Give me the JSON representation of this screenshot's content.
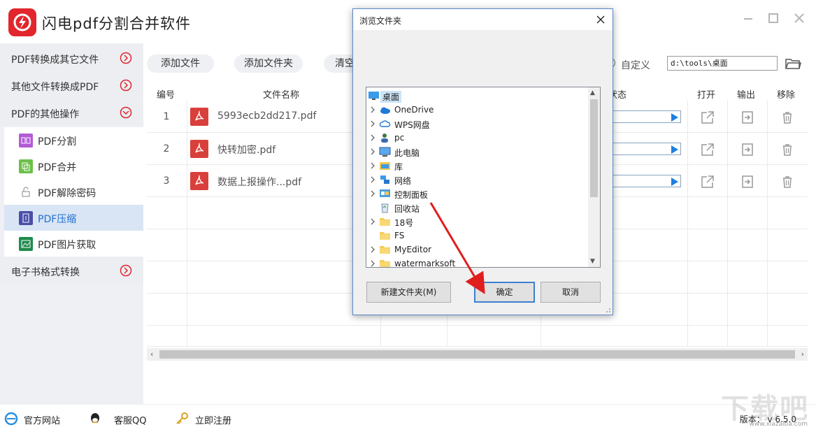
{
  "app": {
    "title": "闪电pdf分割合并软件",
    "brand_color": "#e1262d"
  },
  "sidebar": {
    "categories": [
      {
        "label": "PDF转换成其它文件"
      },
      {
        "label": "其他文件转换成PDF"
      },
      {
        "label": "PDF的其他操作"
      },
      {
        "label": "电子书格式转换"
      }
    ],
    "sub_items": [
      {
        "label": "PDF分割",
        "icon": "split-icon"
      },
      {
        "label": "PDF合并",
        "icon": "merge-icon"
      },
      {
        "label": "PDF解除密码",
        "icon": "unlock-icon"
      },
      {
        "label": "PDF压缩",
        "icon": "compress-icon",
        "active": true
      },
      {
        "label": "PDF图片获取",
        "icon": "image-extract-icon"
      }
    ]
  },
  "toolbar": {
    "add_file": "添加文件",
    "add_folder": "添加文件夹",
    "clear": "清空",
    "custom_label": "自定义",
    "output_path": "d:\\tools\\桌面"
  },
  "table": {
    "headers": {
      "no": "编号",
      "name": "文件名称",
      "status": "状态",
      "open": "打开",
      "output": "输出",
      "remove": "移除"
    },
    "rows": [
      {
        "no": "1",
        "name": "5993ecb2dd217.pdf"
      },
      {
        "no": "2",
        "name": "快转加密.pdf"
      },
      {
        "no": "3",
        "name": "数据上报操作...pdf"
      }
    ]
  },
  "footer": {
    "website": "官方网站",
    "qq": "客服QQ",
    "register": "立即注册",
    "version": "版本： v 6.5.0",
    "watermark": "下载吧",
    "watermark_url": "www.xiazaiba.com"
  },
  "dialog": {
    "title": "浏览文件夹",
    "tree": [
      {
        "label": "桌面",
        "icon": "desktop-icon",
        "expandable": false,
        "selected": true,
        "root": true
      },
      {
        "label": "OneDrive",
        "icon": "onedrive-icon",
        "expandable": true
      },
      {
        "label": "WPS网盘",
        "icon": "wps-cloud-icon",
        "expandable": true
      },
      {
        "label": "pc",
        "icon": "user-icon",
        "expandable": true
      },
      {
        "label": "此电脑",
        "icon": "computer-icon",
        "expandable": true
      },
      {
        "label": "库",
        "icon": "library-icon",
        "expandable": true
      },
      {
        "label": "网络",
        "icon": "network-icon",
        "expandable": true
      },
      {
        "label": "控制面板",
        "icon": "control-panel-icon",
        "expandable": true
      },
      {
        "label": "回收站",
        "icon": "recycle-bin-icon",
        "expandable": false
      },
      {
        "label": "18号",
        "icon": "folder-icon",
        "expandable": true
      },
      {
        "label": "FS",
        "icon": "folder-icon",
        "expandable": false
      },
      {
        "label": "MyEditor",
        "icon": "folder-icon",
        "expandable": true
      },
      {
        "label": "watermarksoft",
        "icon": "folder-icon",
        "expandable": true
      }
    ],
    "new_folder": "新建文件夹(M)",
    "ok": "确定",
    "cancel": "取消"
  }
}
